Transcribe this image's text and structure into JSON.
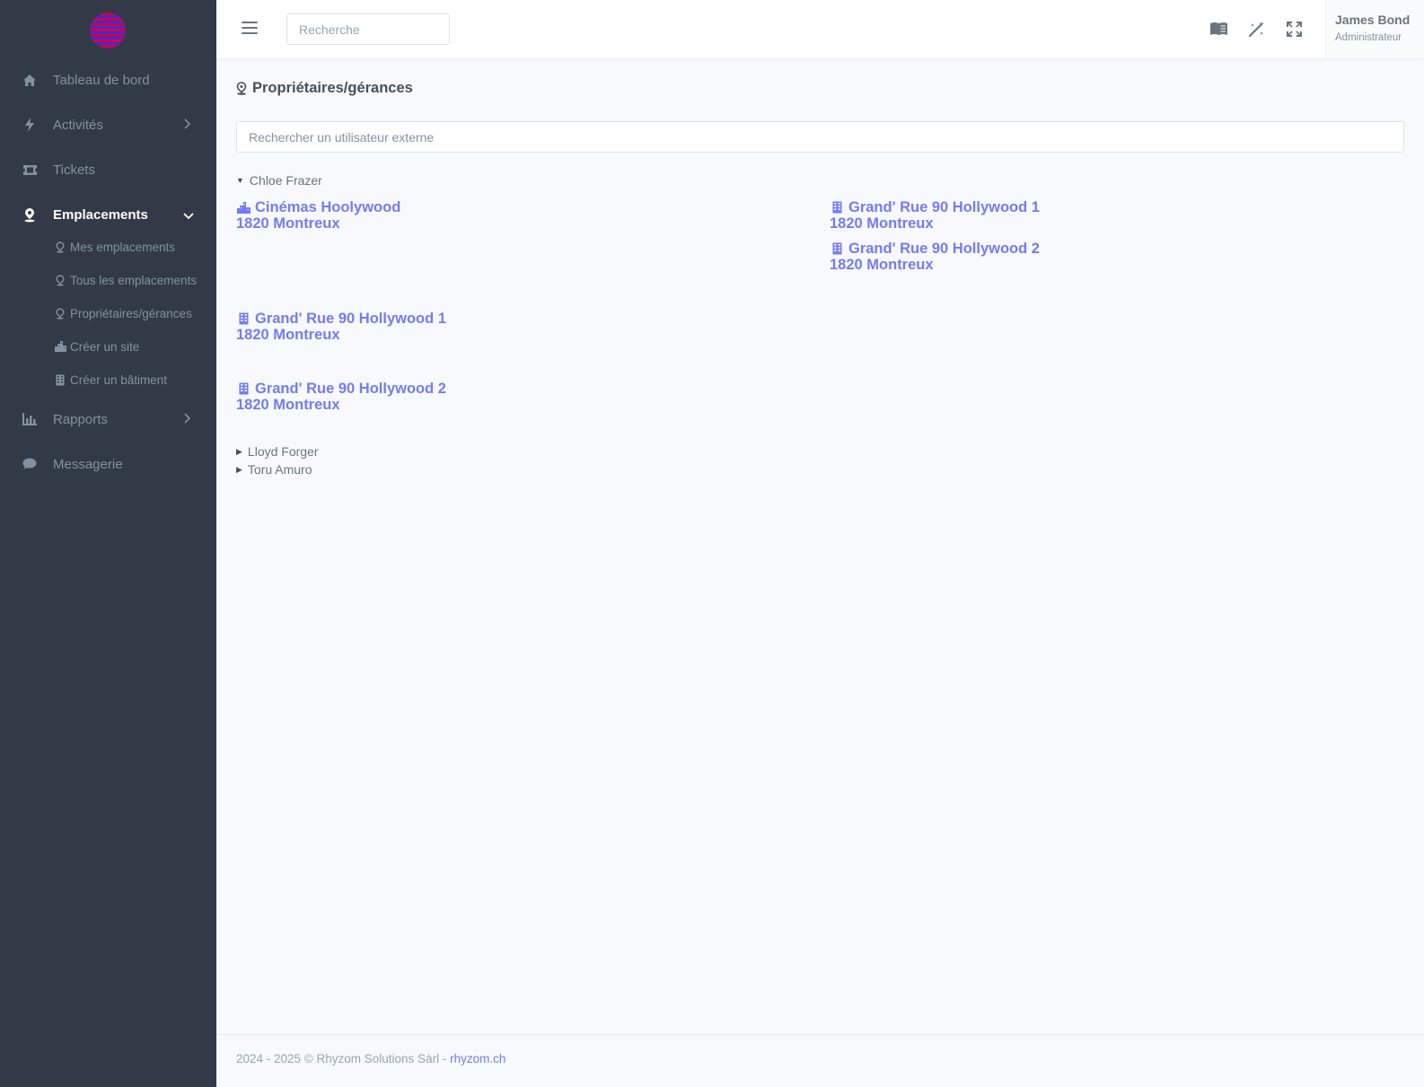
{
  "sidebar": {
    "items": [
      {
        "label": "Tableau de bord",
        "icon": "home-icon"
      },
      {
        "label": "Activités",
        "icon": "bolt-icon"
      },
      {
        "label": "Tickets",
        "icon": "ticket-icon"
      },
      {
        "label": "Emplacements",
        "icon": "location-pin-icon"
      },
      {
        "label": "Rapports",
        "icon": "bar-chart-icon"
      },
      {
        "label": "Messagerie",
        "icon": "chat-icon"
      }
    ],
    "subitems": [
      {
        "label": "Mes emplacements",
        "icon": "location-pin-icon"
      },
      {
        "label": "Tous les emplacements",
        "icon": "location-pin-icon"
      },
      {
        "label": "Propriétaires/gérances",
        "icon": "location-pin-icon"
      },
      {
        "label": "Créer un site",
        "icon": "city-icon"
      },
      {
        "label": "Créer un bâtiment",
        "icon": "building-icon"
      }
    ]
  },
  "topbar": {
    "search_placeholder": "Recherche",
    "user_name": "James Bond",
    "user_role": "Administrateur"
  },
  "page": {
    "title": "Propriétaires/gérances",
    "search_placeholder": "Rechercher un utilisateur externe"
  },
  "owners": [
    {
      "name": "Chloe Frazer",
      "expanded": true,
      "locations": [
        {
          "name": "Cinémas Hoolywood",
          "city": "1820 Montreux",
          "icon": "city-icon"
        },
        {
          "name": "Grand' Rue 90 Hollywood 1",
          "city": "1820 Montreux",
          "icon": "building-icon"
        },
        {
          "name": "Grand' Rue 90 Hollywood 2",
          "city": "1820 Montreux",
          "icon": "building-icon"
        },
        {
          "name": "Grand' Rue 90 Hollywood 1",
          "city": "1820 Montreux",
          "icon": "building-icon"
        },
        {
          "name": "Grand' Rue 90 Hollywood 2",
          "city": "1820 Montreux",
          "icon": "building-icon"
        }
      ]
    },
    {
      "name": "Lloyd Forger",
      "expanded": false
    },
    {
      "name": "Toru Amuro",
      "expanded": false
    }
  ],
  "footer": {
    "text": "2024 - 2025 © Rhyzom Solutions Sàrl - ",
    "link": "rhyzom.ch"
  },
  "colors": {
    "sidebar_bg": "#313a46",
    "accent": "#727cf5",
    "page_bg": "#f8f9fc"
  }
}
